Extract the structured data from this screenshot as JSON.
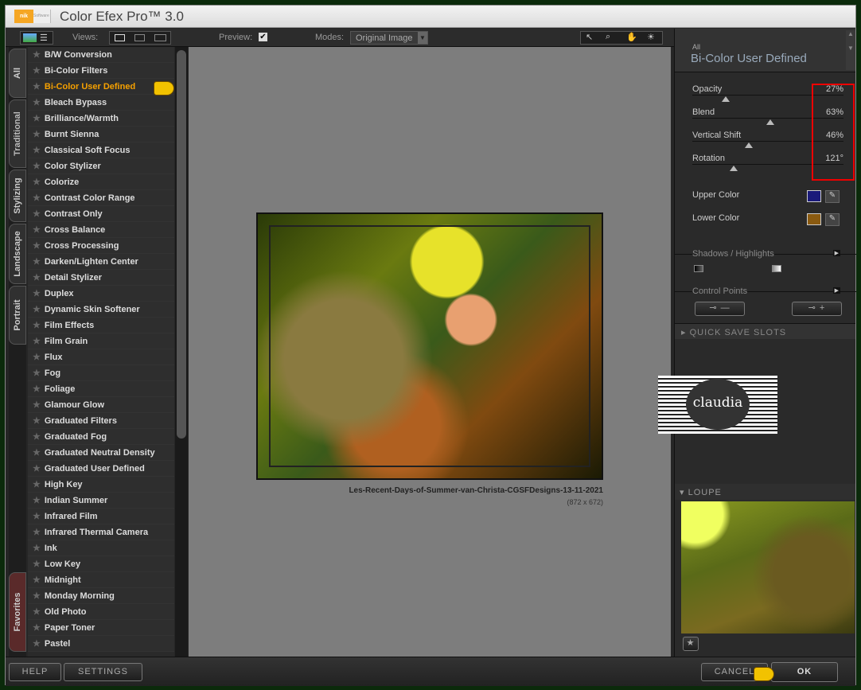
{
  "window": {
    "title": "Color Efex Pro™ 3.0",
    "logo": "nik",
    "logo_sub": "Software"
  },
  "toolbar": {
    "views_label": "Views:",
    "preview_label": "Preview:",
    "preview_checked": true,
    "modes_label": "Modes:",
    "modes_value": "Original Image"
  },
  "tabs": [
    "All",
    "Traditional",
    "Stylizing",
    "Landscape",
    "Portrait",
    "Favorites"
  ],
  "filters": [
    "B/W Conversion",
    "Bi-Color Filters",
    "Bi-Color User Defined",
    "Bleach Bypass",
    "Brilliance/Warmth",
    "Burnt Sienna",
    "Classical Soft Focus",
    "Color Stylizer",
    "Colorize",
    "Contrast Color Range",
    "Contrast Only",
    "Cross Balance",
    "Cross Processing",
    "Darken/Lighten Center",
    "Detail Stylizer",
    "Duplex",
    "Dynamic Skin Softener",
    "Film Effects",
    "Film Grain",
    "Flux",
    "Fog",
    "Foliage",
    "Glamour Glow",
    "Graduated Filters",
    "Graduated Fog",
    "Graduated Neutral Density",
    "Graduated User Defined",
    "High Key",
    "Indian Summer",
    "Infrared Film",
    "Infrared Thermal Camera",
    "Ink",
    "Low Key",
    "Midnight",
    "Monday Morning",
    "Old Photo",
    "Paper Toner",
    "Pastel"
  ],
  "selected_filter": "Bi-Color User Defined",
  "preview": {
    "filename": "Les-Recent-Days-of-Summer-van-Christa-CGSFDesigns-13-11-2021",
    "dimensions": "(872 x 672)"
  },
  "panel": {
    "category": "All",
    "filter_name": "Bi-Color User Defined",
    "sliders": [
      {
        "label": "Opacity",
        "value": "27%",
        "level": 0.27
      },
      {
        "label": "Blend",
        "value": "63%",
        "level": 0.63
      },
      {
        "label": "Vertical Shift",
        "value": "46%",
        "level": 0.46
      },
      {
        "label": "Rotation",
        "value": "121°",
        "level": 0.336
      }
    ],
    "upper_color_label": "Upper Color",
    "upper_color": "#1a1a7a",
    "lower_color_label": "Lower Color",
    "lower_color": "#8a5a10",
    "shadows_highlights": "Shadows / Highlights",
    "control_points": "Control Points",
    "quick_save": "QUICK SAVE SLOTS",
    "loupe": "LOUPE"
  },
  "watermark": "claudia",
  "buttons": {
    "help": "HELP",
    "settings": "SETTINGS",
    "cancel": "CANCEL",
    "ok": "OK"
  }
}
